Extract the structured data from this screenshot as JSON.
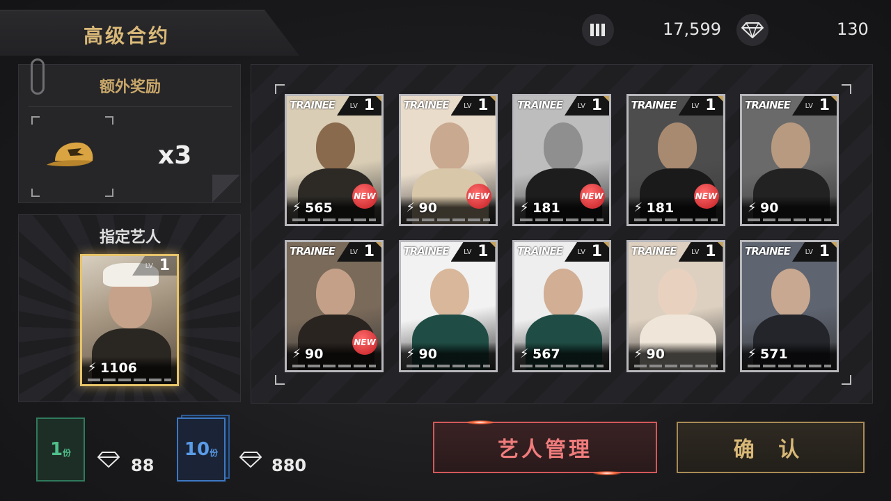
{
  "header": {
    "title": "高级合约",
    "currency_1_value": "17,599",
    "currency_2_value": "130"
  },
  "bonus": {
    "title": "额外奖励",
    "quantity": "x3",
    "item_icon": "cap-icon"
  },
  "designated_artist": {
    "title": "指定艺人",
    "lv_label": "LV",
    "level": "1",
    "power": "1106"
  },
  "cards": [
    {
      "brand": "TRAINEE",
      "lv_label": "LV",
      "level": "1",
      "power": "565",
      "is_new": true,
      "new_label": "NEW"
    },
    {
      "brand": "TRAINEE",
      "lv_label": "LV",
      "level": "1",
      "power": "90",
      "is_new": true,
      "new_label": "NEW"
    },
    {
      "brand": "TRAINEE",
      "lv_label": "LV",
      "level": "1",
      "power": "181",
      "is_new": true,
      "new_label": "NEW"
    },
    {
      "brand": "TRAINEE",
      "lv_label": "LV",
      "level": "1",
      "power": "181",
      "is_new": true,
      "new_label": "NEW"
    },
    {
      "brand": "TRAINEE",
      "lv_label": "LV",
      "level": "1",
      "power": "90",
      "is_new": false,
      "new_label": ""
    },
    {
      "brand": "TRAINEE",
      "lv_label": "LV",
      "level": "1",
      "power": "90",
      "is_new": true,
      "new_label": "NEW"
    },
    {
      "brand": "TRAINEE",
      "lv_label": "LV",
      "level": "1",
      "power": "90",
      "is_new": false,
      "new_label": ""
    },
    {
      "brand": "TRAINEE",
      "lv_label": "LV",
      "level": "1",
      "power": "567",
      "is_new": false,
      "new_label": ""
    },
    {
      "brand": "TRAINEE",
      "lv_label": "LV",
      "level": "1",
      "power": "90",
      "is_new": false,
      "new_label": ""
    },
    {
      "brand": "TRAINEE",
      "lv_label": "LV",
      "level": "1",
      "power": "571",
      "is_new": false,
      "new_label": ""
    }
  ],
  "packs": [
    {
      "count": "1",
      "unit": "份",
      "price": "88",
      "color": "#2f7a5c"
    },
    {
      "count": "10",
      "unit": "份",
      "price": "880",
      "color": "#2d5a95"
    }
  ],
  "buttons": {
    "manage_label": "艺人管理",
    "confirm_label": "确 认"
  },
  "colors": {
    "gold_accent": "#d9b878",
    "manage_red": "#f07c7c",
    "new_badge": "#c21d22"
  }
}
